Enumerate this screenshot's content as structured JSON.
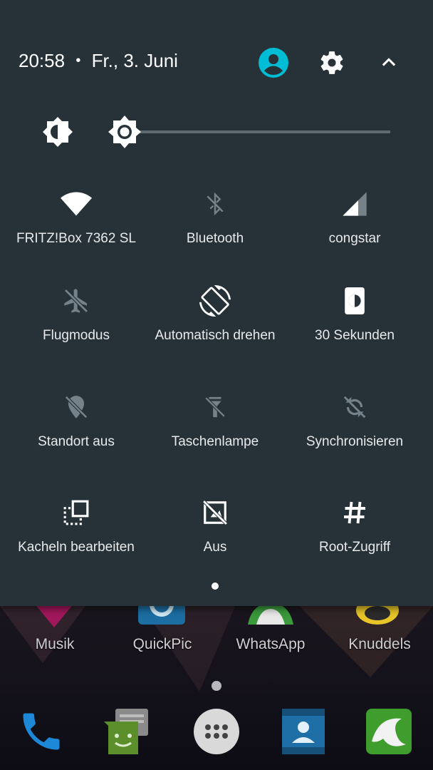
{
  "header": {
    "time": "20:58",
    "separator": "•",
    "date": "Fr., 3. Juni",
    "icons": [
      "user-account-icon",
      "settings-gear-icon",
      "collapse-chevron-up-icon"
    ]
  },
  "brightness": {
    "auto_icon": "auto-brightness-icon",
    "level": 0.05
  },
  "tiles": [
    {
      "label": "FRITZ!Box 7362 SL",
      "icon": "wifi-icon",
      "active": true
    },
    {
      "label": "Bluetooth",
      "icon": "bluetooth-off-icon",
      "active": false
    },
    {
      "label": "congstar",
      "icon": "signal-icon",
      "active": true
    },
    {
      "label": "Flugmodus",
      "icon": "airplane-icon",
      "active": false
    },
    {
      "label": "Automatisch drehen",
      "icon": "auto-rotate-icon",
      "active": true
    },
    {
      "label": "30 Sekunden",
      "icon": "screen-timeout-icon",
      "active": true
    },
    {
      "label": "Standort aus",
      "icon": "location-off-icon",
      "active": false
    },
    {
      "label": "Taschenlampe",
      "icon": "flashlight-off-icon",
      "active": false
    },
    {
      "label": "Synchronisieren",
      "icon": "sync-off-icon",
      "active": false
    },
    {
      "label": "Kacheln bearbeiten",
      "icon": "edit-tiles-icon",
      "active": true
    },
    {
      "label": "Aus",
      "icon": "screen-off-icon",
      "active": true
    },
    {
      "label": "Root-Zugriff",
      "icon": "hash-icon",
      "active": true
    }
  ],
  "home": {
    "apps": [
      "Musik",
      "QuickPic",
      "WhatsApp",
      "Knuddels"
    ],
    "dock": [
      "phone-icon",
      "messaging-icon",
      "app-drawer-icon",
      "contacts-icon",
      "dolphin-browser-icon"
    ]
  },
  "colors": {
    "panel": "#263238",
    "active": "#ffffff",
    "inactive": "#75828a",
    "accent": "#00bcd4"
  }
}
